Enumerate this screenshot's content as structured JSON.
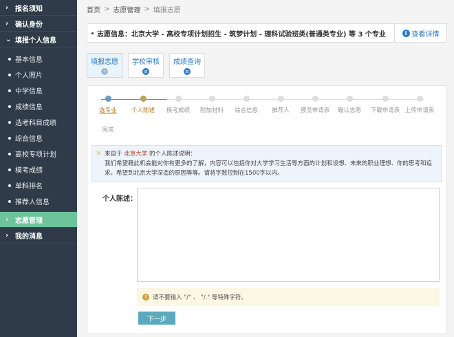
{
  "sidebar": {
    "items": [
      {
        "label": "报名须知"
      },
      {
        "label": "确认身份"
      },
      {
        "label": "填报个人信息"
      }
    ],
    "sub_items": [
      {
        "label": "基本信息"
      },
      {
        "label": "个人照片"
      },
      {
        "label": "中学信息"
      },
      {
        "label": "成绩信息"
      },
      {
        "label": "选考科目成绩"
      },
      {
        "label": "综合信息"
      },
      {
        "label": "高校专项计划"
      },
      {
        "label": "模考成绩"
      },
      {
        "label": "单科排名"
      },
      {
        "label": "推荐人信息"
      }
    ],
    "bottom_items": [
      {
        "label": "志愿管理"
      },
      {
        "label": "我的消息"
      }
    ]
  },
  "breadcrumb": {
    "home": "首页",
    "section": "志愿管理",
    "current": "填报志愿",
    "separator": ">"
  },
  "info_bar": {
    "text": "志愿信息：北京大学 - 高校专项计划招生 - 筑梦计划 - 理科试验班类(普通类专业) 等 3 个专业",
    "detail_label": "查看详情"
  },
  "tabs": [
    {
      "label": "填报志愿",
      "icon_glyph": "›"
    },
    {
      "label": "学校审核",
      "icon_glyph": "≡"
    },
    {
      "label": "成绩查询",
      "icon_glyph": "≡"
    }
  ],
  "steps": [
    {
      "label": "选专业",
      "status": "done"
    },
    {
      "label": "个人陈述",
      "status": "current"
    },
    {
      "label": "模考成绩",
      "status": "todo"
    },
    {
      "label": "附加材料",
      "status": "todo"
    },
    {
      "label": "综合信息",
      "status": "todo"
    },
    {
      "label": "推荐人",
      "status": "todo"
    },
    {
      "label": "预览申请表",
      "status": "todo"
    },
    {
      "label": "确认志愿",
      "status": "todo"
    },
    {
      "label": "下载申请表",
      "status": "todo"
    },
    {
      "label": "上传申请表",
      "status": "todo"
    },
    {
      "label": "完成",
      "status": "todo"
    }
  ],
  "notice": {
    "prefix": "来自于",
    "school": "北京大学",
    "suffix": "的个人陈述说明：",
    "body": "我们希望藉此机会能对你有更多的了解，内容可以包括你对大学学习生活等方面的计划和设想、未来的职业理想、你的思考和追求，希望到北京大学深造的原因等等。请将字数控制在1500字以内。"
  },
  "form": {
    "label": "个人陈述：",
    "value": ""
  },
  "warning": {
    "text": "请不要输入 \"/\" 、 \"/.\" 等特殊字符。"
  },
  "next_button": {
    "label": "下一步"
  },
  "colors": {
    "sidebar_bg": "#2f3b48",
    "active_item": "#6cc49b",
    "accent": "#2e7ac9",
    "highlight": "#c0392b",
    "button": "#5aa9bd"
  }
}
